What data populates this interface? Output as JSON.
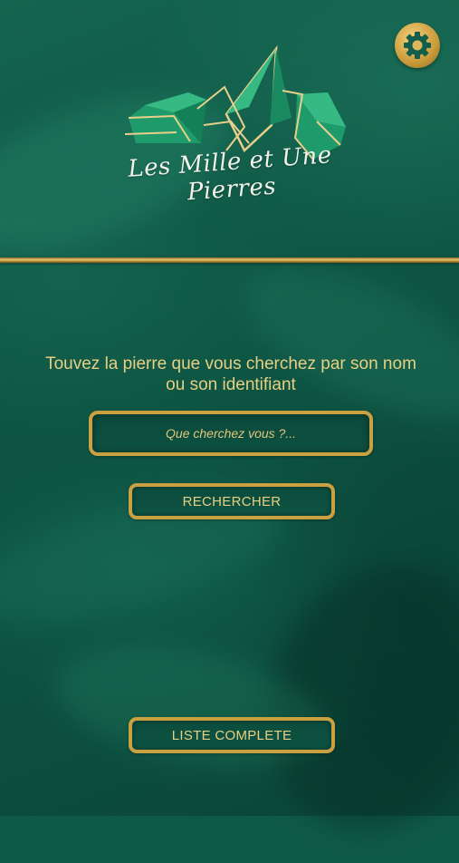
{
  "header": {
    "logo_text": "Les Mille et Une Pierres",
    "settings_icon": "gear-icon"
  },
  "search": {
    "headline": "Touvez la pierre que vous cherchez par son nom ou son identifiant",
    "placeholder": "Que cherchez vous ?...",
    "value": "",
    "search_button_label": "RECHERCHER"
  },
  "footer": {
    "list_button_label": "LISTE COMPLETE"
  },
  "colors": {
    "background": "#0f5a47",
    "gold": "#c9a042",
    "gold_text": "#e8cf82",
    "emerald": "#1f9a6a"
  }
}
